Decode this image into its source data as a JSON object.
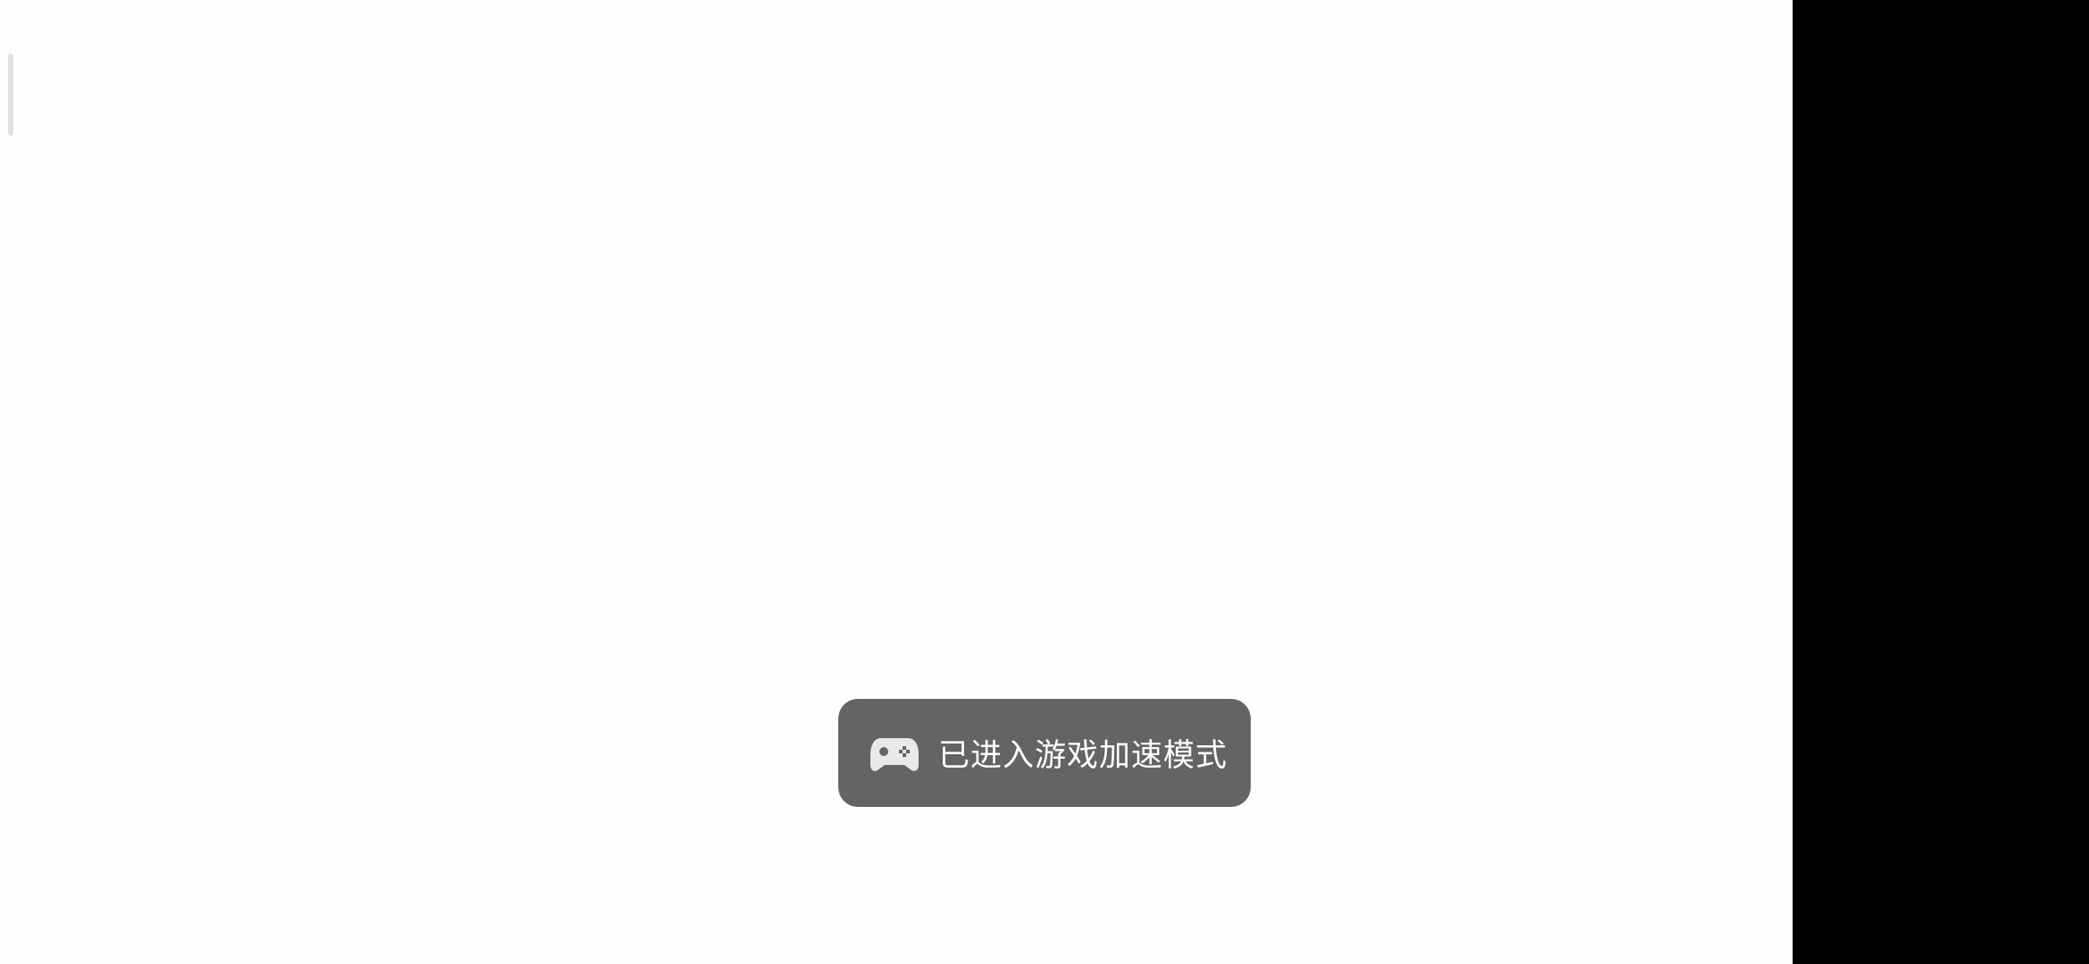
{
  "toast": {
    "icon": "gamepad-icon",
    "message": "已进入游戏加速模式"
  },
  "colors": {
    "screen_background": "#fefefe",
    "toast_background": "#646464",
    "toast_text": "#ffffff",
    "side_bar": "#000000"
  }
}
